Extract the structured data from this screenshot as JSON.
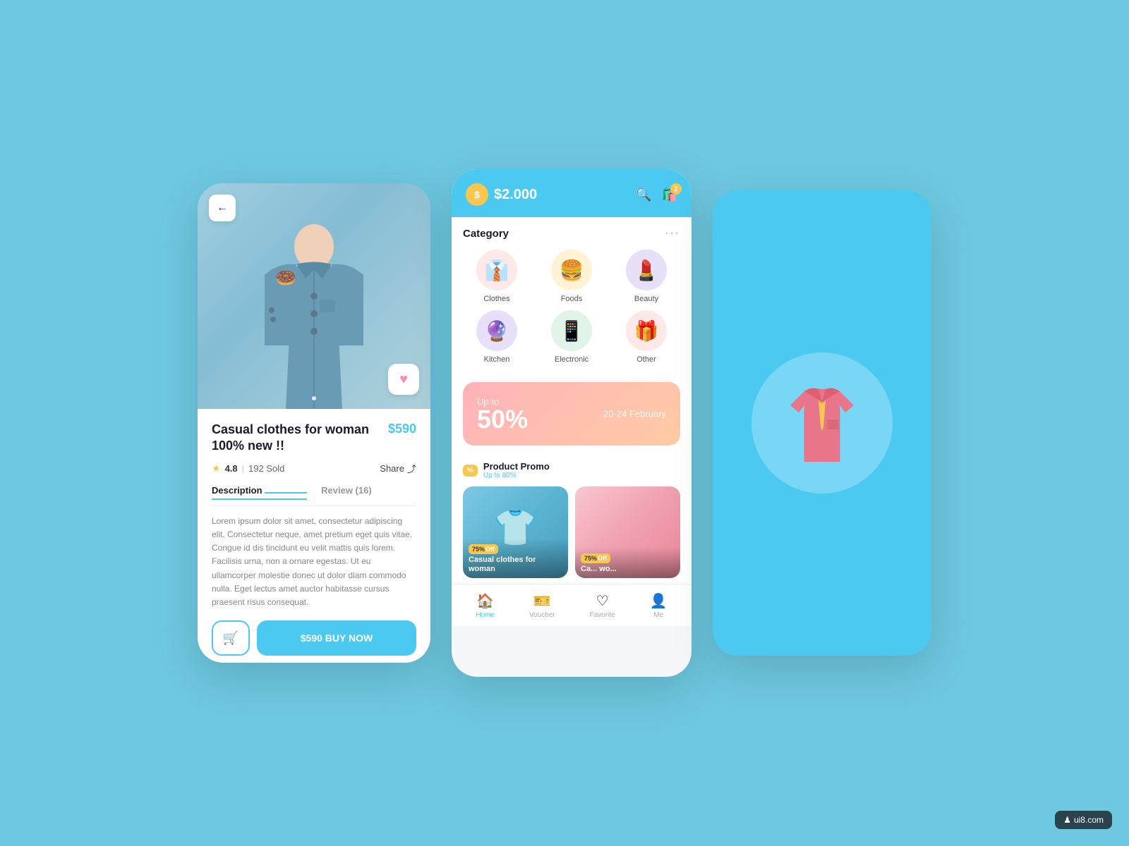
{
  "background_color": "#6dc8e0",
  "phone1": {
    "product_title": "Casual clothes for woman 100% new !!",
    "product_price": "$590",
    "rating": "4.8",
    "sold_count": "192 Sold",
    "share_label": "Share",
    "description_tab": "Description",
    "review_tab": "Review (16)",
    "description_text": "Lorem ipsum dolor sit amet, consectetur adipiscing elit. Consectetur neque, amet pretium eget quis vitae. Congue id dis tincidunt eu velit mattis quis lorem. Facilisis urna, non a ornare egestas. Ut eu ullamcorper molestie donec ut dolor diam commodo nulla. Eget lectus amet auctor habitasse cursus praesent risus consequat.",
    "buy_button": "$590 BUY NOW",
    "back_arrow": "←"
  },
  "phone2": {
    "balance": "$2.000",
    "dollar_sign": "$",
    "cart_badge": "2",
    "category_title": "Category",
    "more_dots": "···",
    "categories": [
      {
        "name": "Clothes",
        "icon": "👔",
        "bg": "cat-clothes"
      },
      {
        "name": "Foods",
        "icon": "🍔",
        "bg": "cat-foods"
      },
      {
        "name": "Beauty",
        "icon": "💄",
        "bg": "cat-beauty"
      },
      {
        "name": "Kitchen",
        "icon": "🔮",
        "bg": "cat-kitchen"
      },
      {
        "name": "Electronic",
        "icon": "📱",
        "bg": "cat-electronic"
      },
      {
        "name": "Other",
        "icon": "🎁",
        "bg": "cat-other"
      }
    ],
    "promo_up_to": "Up to",
    "promo_percent": "50%",
    "promo_date": "20-24 February",
    "product_promo_title": "Product Promo",
    "product_promo_sub": "Up to 80%",
    "product_card1_discount": "75%",
    "product_card1_off": "Off",
    "product_card1_title": "Casual clothes for woman",
    "product_card2_discount": "75%",
    "product_card2_off": "Off",
    "product_card2_title": "Ca... wo...",
    "nav_items": [
      {
        "label": "Home",
        "icon": "🏠",
        "active": true
      },
      {
        "label": "Voucher",
        "icon": "🎫",
        "active": false
      },
      {
        "label": "Favorite",
        "icon": "♡",
        "active": false
      },
      {
        "label": "Me",
        "icon": "👤",
        "active": false
      }
    ]
  },
  "phone3": {
    "background": "#4cc9f0"
  },
  "watermark": {
    "logo": "♟",
    "text": "ui8.com"
  }
}
